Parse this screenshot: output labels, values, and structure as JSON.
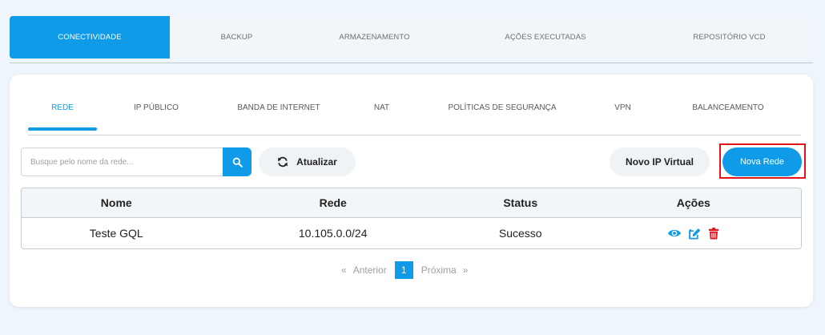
{
  "top_tabs": [
    "CONECTIVIDADE",
    "BACKUP",
    "ARMAZENAMENTO",
    "AÇÕES EXECUTADAS",
    "REPOSITÓRIO VCD"
  ],
  "sub_tabs": [
    "REDE",
    "IP PÚBLICO",
    "BANDA DE INTERNET",
    "NAT",
    "POLÍTICAS DE SEGURANÇA",
    "VPN",
    "BALANCEAMENTO"
  ],
  "search": {
    "placeholder": "Busque pelo nome da rede...",
    "value": ""
  },
  "buttons": {
    "refresh": "Atualizar",
    "virtual_ip": "Novo IP Virtual",
    "new_network": "Nova Rede"
  },
  "table": {
    "headers": [
      "Nome",
      "Rede",
      "Status",
      "Ações"
    ],
    "rows": [
      {
        "name": "Teste GQL",
        "network": "10.105.0.0/24",
        "status": "Sucesso"
      }
    ]
  },
  "pagination": {
    "prev": "Anterior",
    "page": "1",
    "next": "Próxima",
    "prev_glyph": "«",
    "next_glyph": "»"
  },
  "icons": {
    "search": "search-icon",
    "refresh": "refresh-icon",
    "view": "eye-icon",
    "edit": "edit-icon",
    "delete": "trash-icon"
  },
  "colors": {
    "accent": "#0f9be8",
    "danger": "#e0141b",
    "highlight": "#e0141b"
  }
}
